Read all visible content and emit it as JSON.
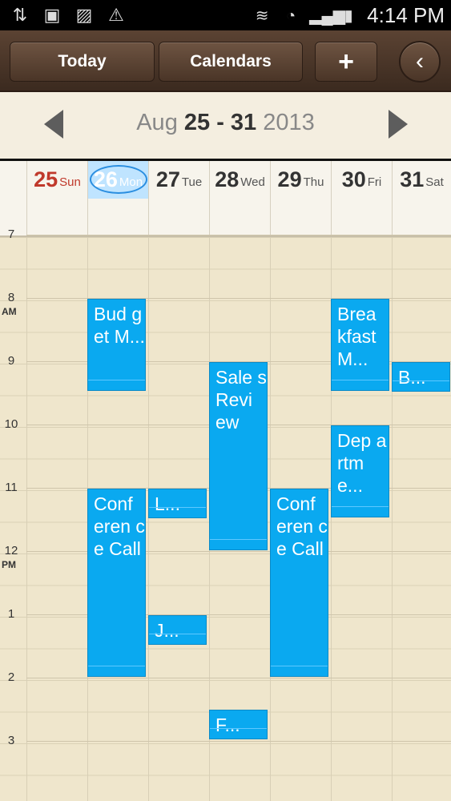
{
  "statusbar": {
    "left_icons": [
      "usb-icon",
      "sd-card-icon",
      "image-icon",
      "warning-icon"
    ],
    "right_icons": [
      "vibrate-icon",
      "wifi-icon",
      "signal-icon",
      "battery-icon"
    ],
    "time": "4:14 PM"
  },
  "toolbar": {
    "today_label": "Today",
    "calendars_label": "Calendars",
    "add_label": "+",
    "back_label": "‹"
  },
  "week": {
    "month": "Aug",
    "range": "25 - 31",
    "year": "2013"
  },
  "days": [
    {
      "num": "25",
      "wk": "Sun"
    },
    {
      "num": "26",
      "wk": "Mon"
    },
    {
      "num": "27",
      "wk": "Tue"
    },
    {
      "num": "28",
      "wk": "Wed"
    },
    {
      "num": "29",
      "wk": "Thu"
    },
    {
      "num": "30",
      "wk": "Fri"
    },
    {
      "num": "31",
      "wk": "Sat"
    }
  ],
  "hours": [
    "7",
    "8",
    "9",
    "10",
    "11",
    "12",
    "1",
    "2",
    "3"
  ],
  "am_label": "AM",
  "pm_label": "PM",
  "events": [
    {
      "title": "Bud get M...",
      "day": "Mon",
      "start": "8:00",
      "end": "9:30"
    },
    {
      "title": "Conf eren ce Call",
      "day": "Mon",
      "start": "11:00",
      "end": "2:00"
    },
    {
      "title": "L...",
      "day": "Tue",
      "start": "11:00",
      "end": "11:30"
    },
    {
      "title": "J...",
      "day": "Tue",
      "start": "1:00",
      "end": "1:30"
    },
    {
      "title": "Sale s Revi ew",
      "day": "Wed",
      "start": "9:00",
      "end": "12:00"
    },
    {
      "title": "F...",
      "day": "Wed",
      "start": "2:30",
      "end": "3:00"
    },
    {
      "title": "Conf eren ce Call",
      "day": "Thu",
      "start": "11:00",
      "end": "2:00"
    },
    {
      "title": "Brea kfast M...",
      "day": "Fri",
      "start": "8:00",
      "end": "9:30"
    },
    {
      "title": "Dep artm e...",
      "day": "Fri",
      "start": "10:00",
      "end": "11:30"
    },
    {
      "title": "B...",
      "day": "Sat",
      "start": "9:00",
      "end": "9:30"
    }
  ],
  "colors": {
    "event": "#0aa9f0",
    "sunday": "#c0392b",
    "today_highlight": "#bfe4ff",
    "toolbar": "#4a3527"
  }
}
